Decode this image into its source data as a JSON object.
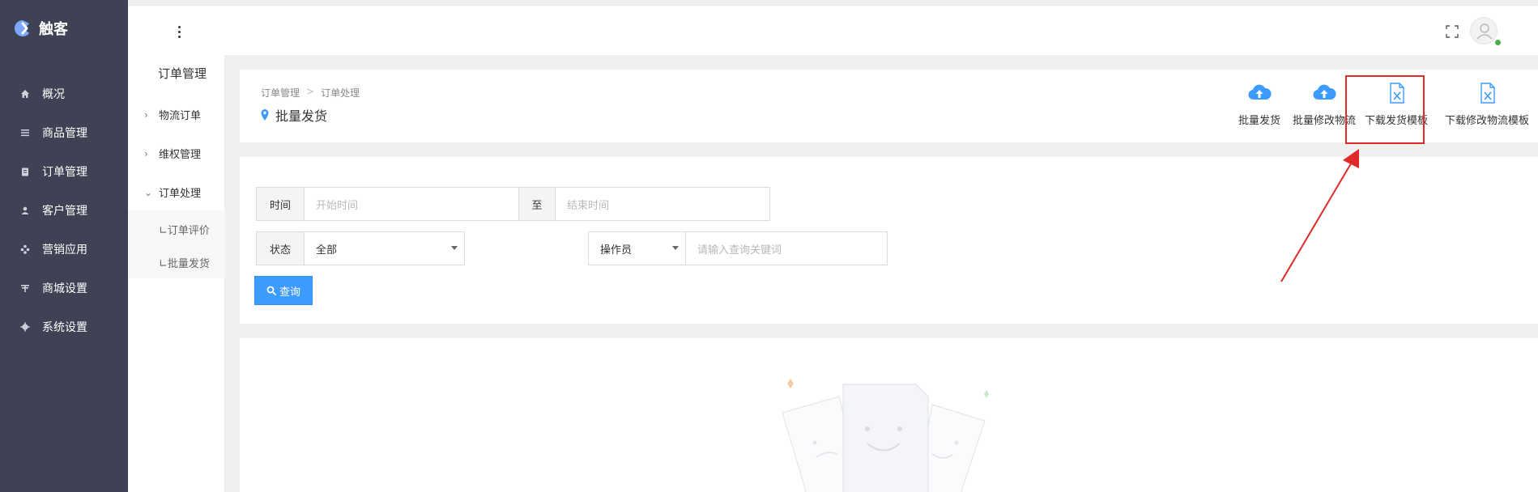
{
  "app": {
    "name": "触客"
  },
  "sidebar": {
    "items": [
      {
        "label": "概况",
        "icon": "home-icon"
      },
      {
        "label": "商品管理",
        "icon": "list-icon"
      },
      {
        "label": "订单管理",
        "icon": "clipboard-icon"
      },
      {
        "label": "客户管理",
        "icon": "user-icon"
      },
      {
        "label": "营销应用",
        "icon": "puzzle-icon"
      },
      {
        "label": "商城设置",
        "icon": "store-icon"
      },
      {
        "label": "系统设置",
        "icon": "gear-icon"
      }
    ]
  },
  "submenu": {
    "title": "订单管理",
    "items": [
      {
        "label": "物流订单",
        "chevron": "›"
      },
      {
        "label": "维权管理",
        "chevron": "›"
      },
      {
        "label": "订单处理",
        "chevron": "⌄"
      }
    ],
    "children": [
      {
        "label": "∟订单评价"
      },
      {
        "label": "∟批量发货"
      }
    ]
  },
  "breadcrumb": {
    "items": [
      "订单管理",
      ">",
      "订单处理"
    ]
  },
  "page": {
    "title": "批量发货"
  },
  "actions": [
    {
      "label": "批量发货",
      "icon": "cloud-upload-icon"
    },
    {
      "label": "批量修改物流",
      "icon": "cloud-upload-icon"
    },
    {
      "label": "下载发货模板",
      "icon": "excel-file-icon"
    },
    {
      "label": "下载修改物流模板",
      "icon": "excel-file-icon"
    }
  ],
  "filters": {
    "time_label": "时间",
    "start_placeholder": "开始时间",
    "to_label": "至",
    "end_placeholder": "结束时间",
    "status_label": "状态",
    "status_value": "全部",
    "operator_value": "操作员",
    "keyword_placeholder": "请输入查询关键词",
    "query_label": "查询"
  },
  "colors": {
    "sidebar": "#3f4254",
    "accent": "#3b9bff",
    "highlight": "#e02a2a"
  }
}
